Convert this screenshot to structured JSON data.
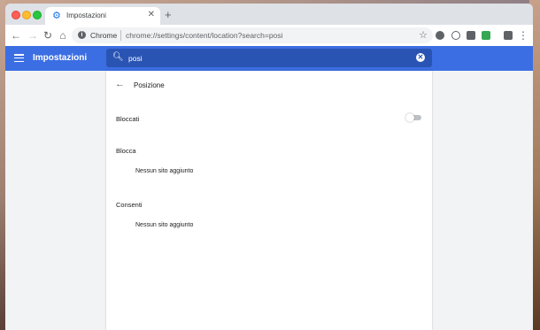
{
  "browser": {
    "tab_title": "Impostazioni",
    "new_tab_label": "+",
    "omnibox": {
      "chrome_label": "Chrome",
      "url": "chrome://settings/content/location?search=posi"
    }
  },
  "settings": {
    "header_title": "Impostazioni",
    "search_value": "posi",
    "page_title": "Posizione",
    "blocked_toggle_label": "Bloccati",
    "blocked_toggle_on": false,
    "block_section": {
      "label": "Blocca",
      "empty_text": "Nessun sito aggiunto"
    },
    "allow_section": {
      "label": "Consenti",
      "empty_text": "Nessun sito aggiunto"
    }
  },
  "colors": {
    "accent": "#3b6ee2",
    "search_bg": "#2a54b3"
  }
}
